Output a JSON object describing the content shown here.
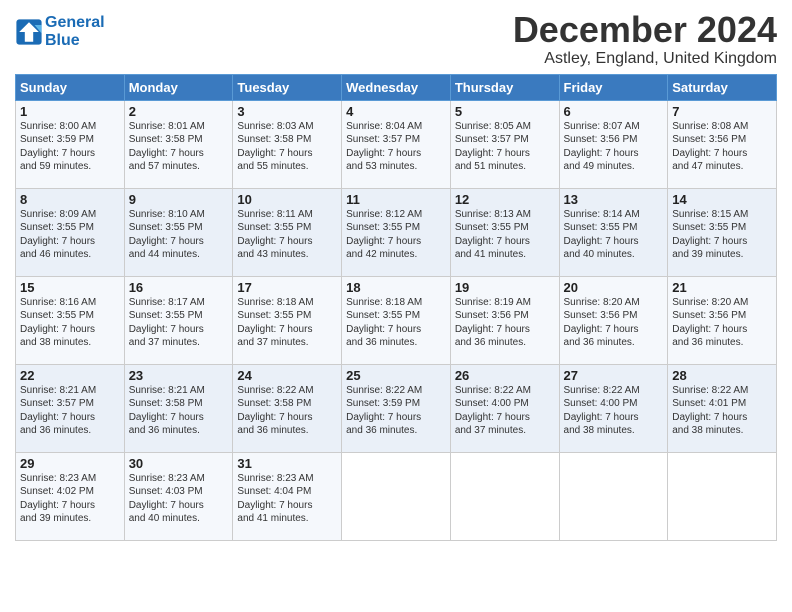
{
  "logo": {
    "line1": "General",
    "line2": "Blue"
  },
  "title": "December 2024",
  "subtitle": "Astley, England, United Kingdom",
  "days_of_week": [
    "Sunday",
    "Monday",
    "Tuesday",
    "Wednesday",
    "Thursday",
    "Friday",
    "Saturday"
  ],
  "weeks": [
    [
      {
        "day": 1,
        "lines": [
          "Sunrise: 8:00 AM",
          "Sunset: 3:59 PM",
          "Daylight: 7 hours",
          "and 59 minutes."
        ]
      },
      {
        "day": 2,
        "lines": [
          "Sunrise: 8:01 AM",
          "Sunset: 3:58 PM",
          "Daylight: 7 hours",
          "and 57 minutes."
        ]
      },
      {
        "day": 3,
        "lines": [
          "Sunrise: 8:03 AM",
          "Sunset: 3:58 PM",
          "Daylight: 7 hours",
          "and 55 minutes."
        ]
      },
      {
        "day": 4,
        "lines": [
          "Sunrise: 8:04 AM",
          "Sunset: 3:57 PM",
          "Daylight: 7 hours",
          "and 53 minutes."
        ]
      },
      {
        "day": 5,
        "lines": [
          "Sunrise: 8:05 AM",
          "Sunset: 3:57 PM",
          "Daylight: 7 hours",
          "and 51 minutes."
        ]
      },
      {
        "day": 6,
        "lines": [
          "Sunrise: 8:07 AM",
          "Sunset: 3:56 PM",
          "Daylight: 7 hours",
          "and 49 minutes."
        ]
      },
      {
        "day": 7,
        "lines": [
          "Sunrise: 8:08 AM",
          "Sunset: 3:56 PM",
          "Daylight: 7 hours",
          "and 47 minutes."
        ]
      }
    ],
    [
      {
        "day": 8,
        "lines": [
          "Sunrise: 8:09 AM",
          "Sunset: 3:55 PM",
          "Daylight: 7 hours",
          "and 46 minutes."
        ]
      },
      {
        "day": 9,
        "lines": [
          "Sunrise: 8:10 AM",
          "Sunset: 3:55 PM",
          "Daylight: 7 hours",
          "and 44 minutes."
        ]
      },
      {
        "day": 10,
        "lines": [
          "Sunrise: 8:11 AM",
          "Sunset: 3:55 PM",
          "Daylight: 7 hours",
          "and 43 minutes."
        ]
      },
      {
        "day": 11,
        "lines": [
          "Sunrise: 8:12 AM",
          "Sunset: 3:55 PM",
          "Daylight: 7 hours",
          "and 42 minutes."
        ]
      },
      {
        "day": 12,
        "lines": [
          "Sunrise: 8:13 AM",
          "Sunset: 3:55 PM",
          "Daylight: 7 hours",
          "and 41 minutes."
        ]
      },
      {
        "day": 13,
        "lines": [
          "Sunrise: 8:14 AM",
          "Sunset: 3:55 PM",
          "Daylight: 7 hours",
          "and 40 minutes."
        ]
      },
      {
        "day": 14,
        "lines": [
          "Sunrise: 8:15 AM",
          "Sunset: 3:55 PM",
          "Daylight: 7 hours",
          "and 39 minutes."
        ]
      }
    ],
    [
      {
        "day": 15,
        "lines": [
          "Sunrise: 8:16 AM",
          "Sunset: 3:55 PM",
          "Daylight: 7 hours",
          "and 38 minutes."
        ]
      },
      {
        "day": 16,
        "lines": [
          "Sunrise: 8:17 AM",
          "Sunset: 3:55 PM",
          "Daylight: 7 hours",
          "and 37 minutes."
        ]
      },
      {
        "day": 17,
        "lines": [
          "Sunrise: 8:18 AM",
          "Sunset: 3:55 PM",
          "Daylight: 7 hours",
          "and 37 minutes."
        ]
      },
      {
        "day": 18,
        "lines": [
          "Sunrise: 8:18 AM",
          "Sunset: 3:55 PM",
          "Daylight: 7 hours",
          "and 36 minutes."
        ]
      },
      {
        "day": 19,
        "lines": [
          "Sunrise: 8:19 AM",
          "Sunset: 3:56 PM",
          "Daylight: 7 hours",
          "and 36 minutes."
        ]
      },
      {
        "day": 20,
        "lines": [
          "Sunrise: 8:20 AM",
          "Sunset: 3:56 PM",
          "Daylight: 7 hours",
          "and 36 minutes."
        ]
      },
      {
        "day": 21,
        "lines": [
          "Sunrise: 8:20 AM",
          "Sunset: 3:56 PM",
          "Daylight: 7 hours",
          "and 36 minutes."
        ]
      }
    ],
    [
      {
        "day": 22,
        "lines": [
          "Sunrise: 8:21 AM",
          "Sunset: 3:57 PM",
          "Daylight: 7 hours",
          "and 36 minutes."
        ]
      },
      {
        "day": 23,
        "lines": [
          "Sunrise: 8:21 AM",
          "Sunset: 3:58 PM",
          "Daylight: 7 hours",
          "and 36 minutes."
        ]
      },
      {
        "day": 24,
        "lines": [
          "Sunrise: 8:22 AM",
          "Sunset: 3:58 PM",
          "Daylight: 7 hours",
          "and 36 minutes."
        ]
      },
      {
        "day": 25,
        "lines": [
          "Sunrise: 8:22 AM",
          "Sunset: 3:59 PM",
          "Daylight: 7 hours",
          "and 36 minutes."
        ]
      },
      {
        "day": 26,
        "lines": [
          "Sunrise: 8:22 AM",
          "Sunset: 4:00 PM",
          "Daylight: 7 hours",
          "and 37 minutes."
        ]
      },
      {
        "day": 27,
        "lines": [
          "Sunrise: 8:22 AM",
          "Sunset: 4:00 PM",
          "Daylight: 7 hours",
          "and 38 minutes."
        ]
      },
      {
        "day": 28,
        "lines": [
          "Sunrise: 8:22 AM",
          "Sunset: 4:01 PM",
          "Daylight: 7 hours",
          "and 38 minutes."
        ]
      }
    ],
    [
      {
        "day": 29,
        "lines": [
          "Sunrise: 8:23 AM",
          "Sunset: 4:02 PM",
          "Daylight: 7 hours",
          "and 39 minutes."
        ]
      },
      {
        "day": 30,
        "lines": [
          "Sunrise: 8:23 AM",
          "Sunset: 4:03 PM",
          "Daylight: 7 hours",
          "and 40 minutes."
        ]
      },
      {
        "day": 31,
        "lines": [
          "Sunrise: 8:23 AM",
          "Sunset: 4:04 PM",
          "Daylight: 7 hours",
          "and 41 minutes."
        ]
      },
      null,
      null,
      null,
      null
    ]
  ]
}
